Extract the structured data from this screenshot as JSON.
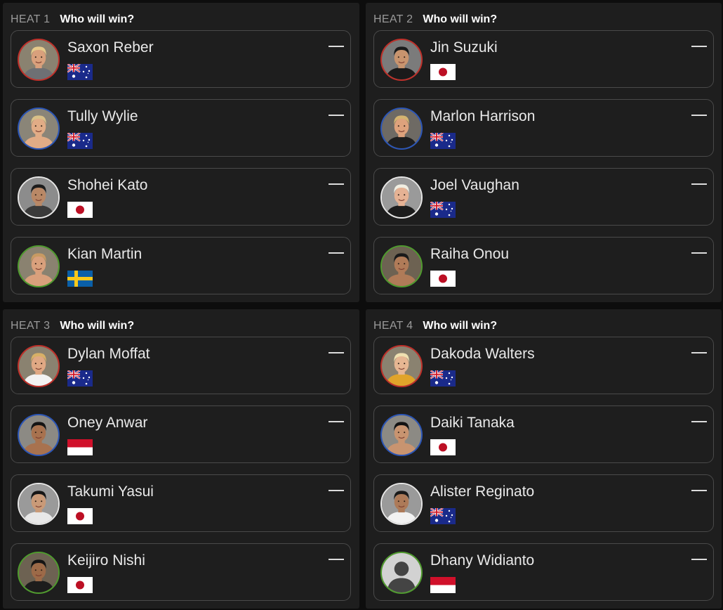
{
  "heats": [
    {
      "label": "HEAT 1",
      "question": "Who will win?",
      "surfers": [
        {
          "name": "Saxon Reber",
          "country": "Australia",
          "flag": "au",
          "ring_color": "#c0302a",
          "odds": "—",
          "avatar": {
            "skin": "#d9a07c",
            "hair": "#e6c98a",
            "shirt": "#6e7074",
            "bg": "#8a8270"
          }
        },
        {
          "name": "Tully Wylie",
          "country": "Australia",
          "flag": "au",
          "ring_color": "#2b56b8",
          "odds": "—",
          "avatar": {
            "skin": "#e1ac86",
            "hair": "#d9c088",
            "shirt": "#e1ac86",
            "bg": "#8a8578"
          }
        },
        {
          "name": "Shohei Kato",
          "country": "Japan",
          "flag": "jp",
          "ring_color": "#e6e6e6",
          "odds": "—",
          "avatar": {
            "skin": "#b98866",
            "hair": "#1c1c1c",
            "shirt": "#3a3a3a",
            "bg": "#8c8c8c"
          }
        },
        {
          "name": "Kian Martin",
          "country": "Sweden",
          "flag": "se",
          "ring_color": "#4f9b2e",
          "odds": "—",
          "avatar": {
            "skin": "#d9a07c",
            "hair": "#c89a62",
            "shirt": "#d9a07c",
            "bg": "#8a8270"
          }
        }
      ]
    },
    {
      "label": "HEAT 2",
      "question": "Who will win?",
      "surfers": [
        {
          "name": "Jin Suzuki",
          "country": "Japan",
          "flag": "jp",
          "ring_color": "#c0302a",
          "odds": "—",
          "avatar": {
            "skin": "#c8946e",
            "hair": "#1a1a1a",
            "shirt": "#1a1a1a",
            "bg": "#7b7b7b"
          }
        },
        {
          "name": "Marlon Harrison",
          "country": "Australia",
          "flag": "au",
          "ring_color": "#2b56b8",
          "odds": "—",
          "avatar": {
            "skin": "#dea27c",
            "hair": "#d4b470",
            "shirt": "#1e1e1e",
            "bg": "#6e6a64"
          }
        },
        {
          "name": "Joel Vaughan",
          "country": "Australia",
          "flag": "au",
          "ring_color": "#e6e6e6",
          "odds": "—",
          "avatar": {
            "skin": "#e5b294",
            "hair": "#f0eee2",
            "shirt": "#1c1c1c",
            "bg": "#9a9a9a"
          }
        },
        {
          "name": "Raiha Onou",
          "country": "Japan",
          "flag": "jp",
          "ring_color": "#4f9b2e",
          "odds": "—",
          "avatar": {
            "skin": "#b07b58",
            "hair": "#1a1a1a",
            "shirt": "#b07b58",
            "bg": "#6d6252"
          }
        }
      ]
    },
    {
      "label": "HEAT 3",
      "question": "Who will win?",
      "surfers": [
        {
          "name": "Dylan Moffat",
          "country": "Australia",
          "flag": "au",
          "ring_color": "#c0302a",
          "odds": "—",
          "avatar": {
            "skin": "#e0a884",
            "hair": "#d8b066",
            "shirt": "#f2f2f2",
            "bg": "#8a8270"
          }
        },
        {
          "name": "Oney Anwar",
          "country": "Indonesia",
          "flag": "id",
          "ring_color": "#2b56b8",
          "odds": "—",
          "avatar": {
            "skin": "#a8724f",
            "hair": "#141414",
            "shirt": "#a8724f",
            "bg": "#8c8a84"
          }
        },
        {
          "name": "Takumi Yasui",
          "country": "Japan",
          "flag": "jp",
          "ring_color": "#e6e6e6",
          "odds": "—",
          "avatar": {
            "skin": "#c99a78",
            "hair": "#161616",
            "shirt": "#e8e8e8",
            "bg": "#9a9a9a"
          }
        },
        {
          "name": "Keijiro Nishi",
          "country": "Japan",
          "flag": "jp",
          "ring_color": "#4f9b2e",
          "odds": "—",
          "avatar": {
            "skin": "#9c6a48",
            "hair": "#141414",
            "shirt": "#1c1c1c",
            "bg": "#6d6252"
          }
        }
      ]
    },
    {
      "label": "HEAT 4",
      "question": "Who will win?",
      "surfers": [
        {
          "name": "Dakoda Walters",
          "country": "Australia",
          "flag": "au",
          "ring_color": "#c0302a",
          "odds": "—",
          "avatar": {
            "skin": "#e6b692",
            "hair": "#efe0b0",
            "shirt": "#e0a42a",
            "bg": "#8a8270"
          }
        },
        {
          "name": "Daiki Tanaka",
          "country": "Japan",
          "flag": "jp",
          "ring_color": "#2b56b8",
          "odds": "—",
          "avatar": {
            "skin": "#c89470",
            "hair": "#121212",
            "shirt": "#c89470",
            "bg": "#8c8a84"
          }
        },
        {
          "name": "Alister Reginato",
          "country": "Australia",
          "flag": "au",
          "ring_color": "#e6e6e6",
          "odds": "—",
          "avatar": {
            "skin": "#ad7a58",
            "hair": "#1a1a1a",
            "shirt": "#f2f2f2",
            "bg": "#9a9a9a"
          }
        },
        {
          "name": "Dhany Widianto",
          "country": "Indonesia",
          "flag": "id",
          "ring_color": "#4f9b2e",
          "odds": "—",
          "avatar": {
            "placeholder": true,
            "skin": "#454545",
            "hair": "#454545",
            "shirt": "#454545",
            "bg": "#d2d2d2"
          }
        }
      ]
    }
  ]
}
